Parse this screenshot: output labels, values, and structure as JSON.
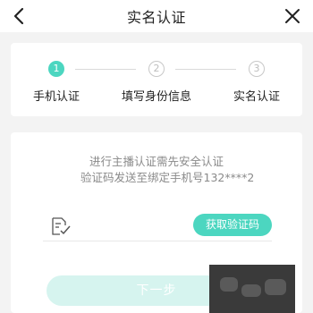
{
  "header": {
    "title": "实名认证",
    "back_icon": "chevron-left-icon",
    "close_icon": "close-icon"
  },
  "steps": [
    {
      "number": "1",
      "label": "手机认证",
      "state": "active"
    },
    {
      "number": "2",
      "label": "填写身份信息",
      "state": "inactive"
    },
    {
      "number": "3",
      "label": "实名认证",
      "state": "inactive"
    }
  ],
  "verify": {
    "line1": "进行主播认证需先安全认证",
    "line2": "验证码发送至绑定手机号132****2",
    "code_icon": "verify-code-icon",
    "code_placeholder": "",
    "get_code_label": "获取验证码",
    "next_label": "下一步"
  },
  "colors": {
    "accent": "#4cd6c0",
    "accent_light": "#d6f4ef",
    "background": "#f3f3f3"
  }
}
